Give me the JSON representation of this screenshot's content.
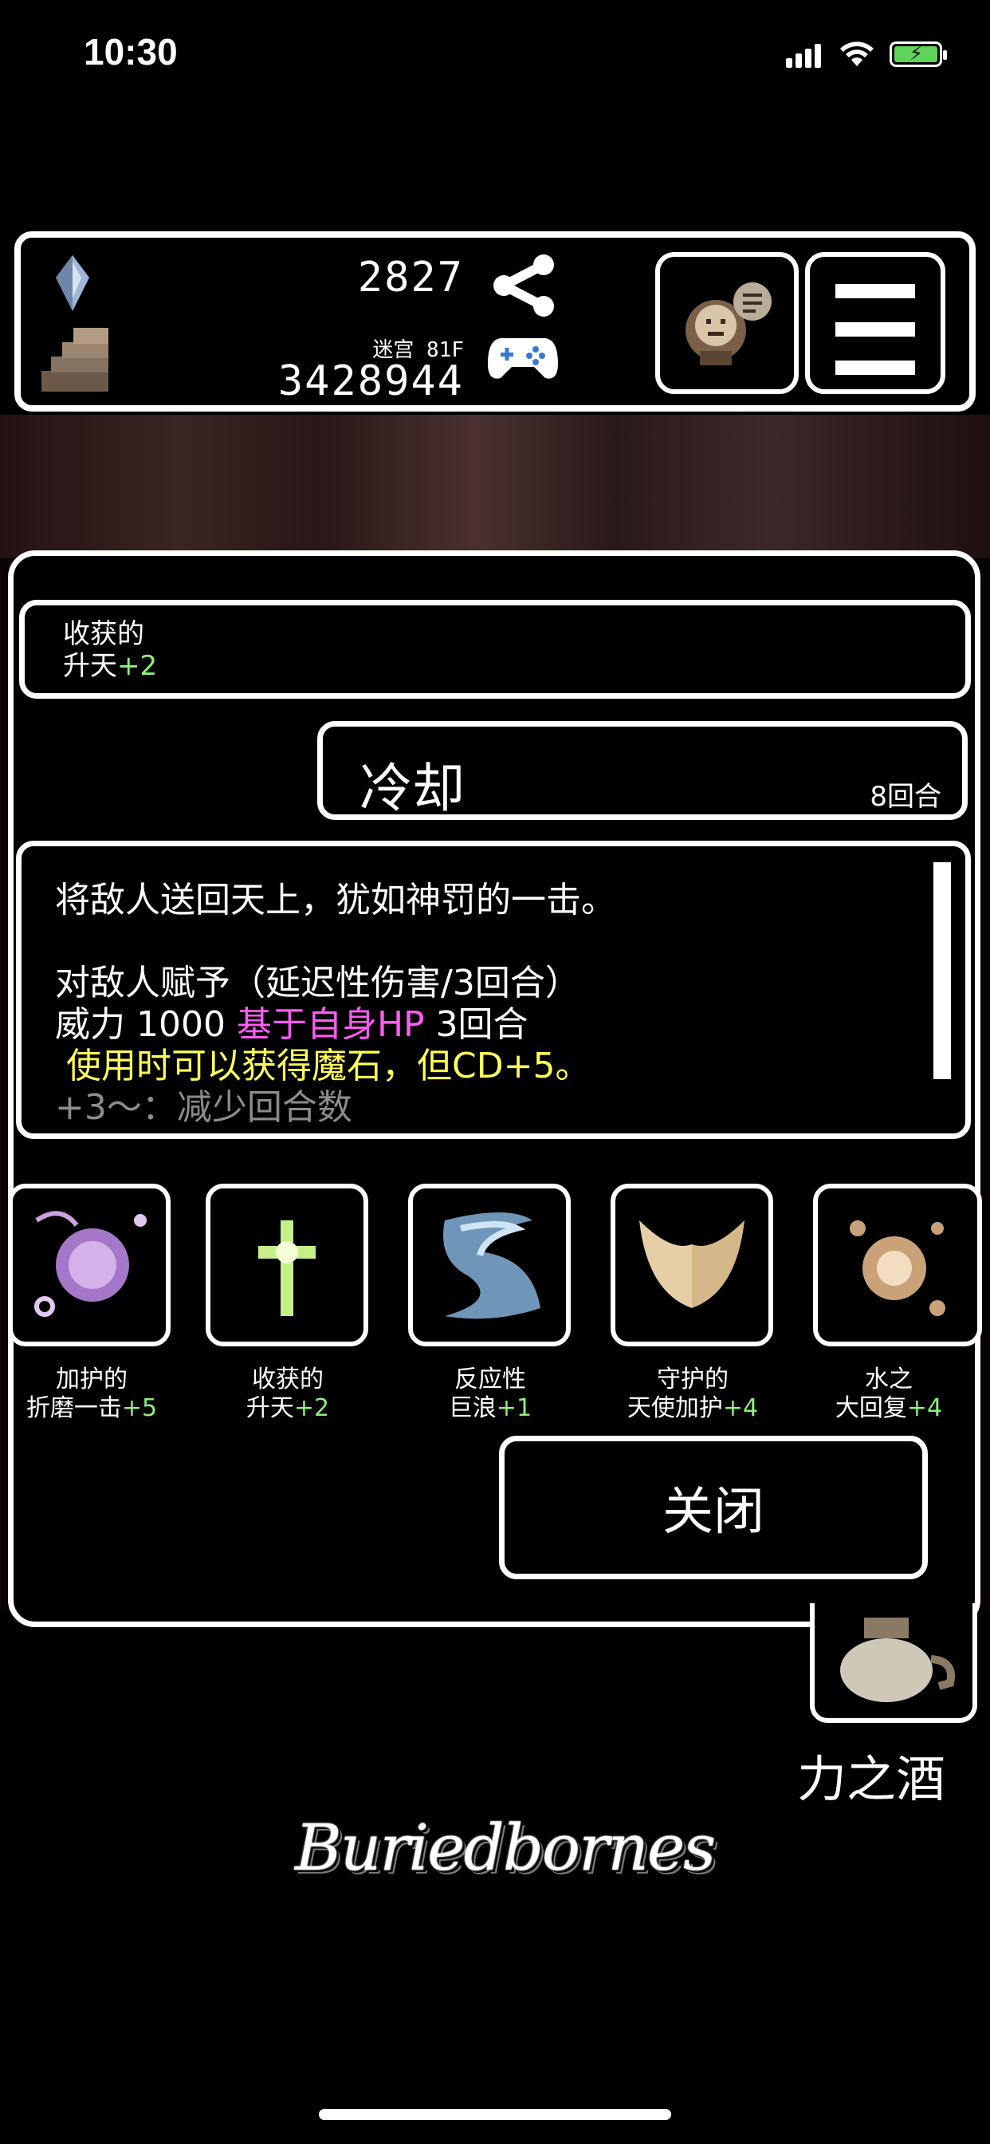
{
  "status_bar": {
    "time": "10:30"
  },
  "header": {
    "currency_amount": "2827",
    "floor_label": "迷宫 81F",
    "score": "3428944"
  },
  "panel": {
    "source_card": {
      "line1": "收获的",
      "line2_name": "升天",
      "line2_bonus": "+2"
    },
    "cooldown": {
      "title": "冷却",
      "turns": "8回合"
    },
    "description": {
      "line1": "将敌人送回天上，犹如神罚的一击。",
      "line2": "对敌人赋予（延迟性伤害/3回合）",
      "line3_prefix": "威力 1000 ",
      "line3_highlight": "基于自身HP",
      "line3_suffix": " 3回合",
      "line4": " 使用时可以获得魔石，但CD+5。",
      "line5": "+3～：减少回合数"
    },
    "skills": [
      {
        "top": "加护的",
        "name": "折磨一击",
        "bonus": "+5"
      },
      {
        "top": "收获的",
        "name": "升天",
        "bonus": "+2"
      },
      {
        "top": "反应性",
        "name": "巨浪",
        "bonus": "+1"
      },
      {
        "top": "守护的",
        "name": "天使加护",
        "bonus": "+4"
      },
      {
        "top": "水之",
        "name": "大回复",
        "bonus": "+4"
      }
    ],
    "close_button": "关闭"
  },
  "potion_label": "力之酒",
  "logo_text": "Buriedbornes",
  "colors": {
    "bonus": "#8df07a",
    "highlight": "#ff5cf5",
    "warning": "#ffff5a",
    "muted": "#8c8c8c"
  }
}
